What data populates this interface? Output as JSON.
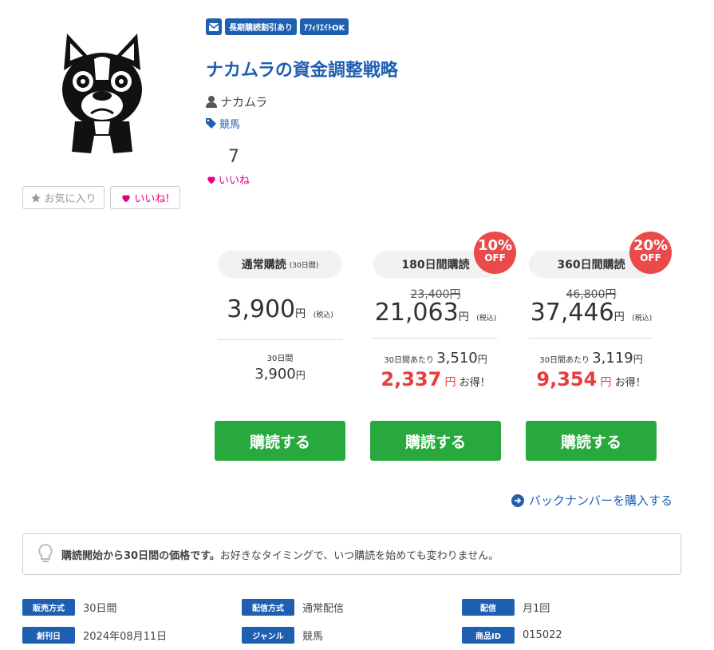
{
  "badges": [
    "長期購読割引あり",
    "ｱﾌｨﾘｴｲﾄOK"
  ],
  "title": "ナカムラの資金調整戦略",
  "author": "ナカムラ",
  "genre": "競馬",
  "likes": {
    "count": "7",
    "label": "いいね"
  },
  "buttons": {
    "favorite": "お気に入り",
    "like": "いいね!"
  },
  "plans": [
    {
      "name": "通常購読",
      "note": "(30日間)",
      "price": "3,900",
      "yen": "円",
      "tax": "(税込)",
      "per_label": "30日間",
      "per_price": "3,900",
      "buy": "購読する"
    },
    {
      "name": "180日間購読",
      "discount": "10%",
      "off": "OFF",
      "original": "23,400円",
      "price": "21,063",
      "yen": "円",
      "tax": "(税込)",
      "per_label": "30日間あたり",
      "per_price": "3,510",
      "save": "2,337",
      "save_suffix": "お得！",
      "buy": "購読する"
    },
    {
      "name": "360日間購読",
      "discount": "20%",
      "off": "OFF",
      "original": "46,800円",
      "price": "37,446",
      "yen": "円",
      "tax": "(税込)",
      "per_label": "30日間あたり",
      "per_price": "3,119",
      "save": "9,354",
      "save_suffix": "お得！",
      "buy": "購読する"
    }
  ],
  "yen": "円",
  "backnumber": "バックナンバーを購入する",
  "notice": {
    "bold": "購読開始から30日間の価格です。",
    "text": "お好きなタイミングで、いつ購読を始めても変わりません。"
  },
  "info": [
    {
      "label": "販売方式",
      "value": "30日間"
    },
    {
      "label": "配信方式",
      "value": "通常配信"
    },
    {
      "label": "配信",
      "value": "月1回"
    },
    {
      "label": "創刊日",
      "value": "2024年08月11日"
    },
    {
      "label": "ジャンル",
      "value": "競馬"
    },
    {
      "label": "商品ID",
      "value": "015022"
    }
  ],
  "colors": {
    "brand": "#1f5fb2",
    "buy": "#28a93e",
    "pink": "#e5007f",
    "save": "#e83c3c"
  }
}
